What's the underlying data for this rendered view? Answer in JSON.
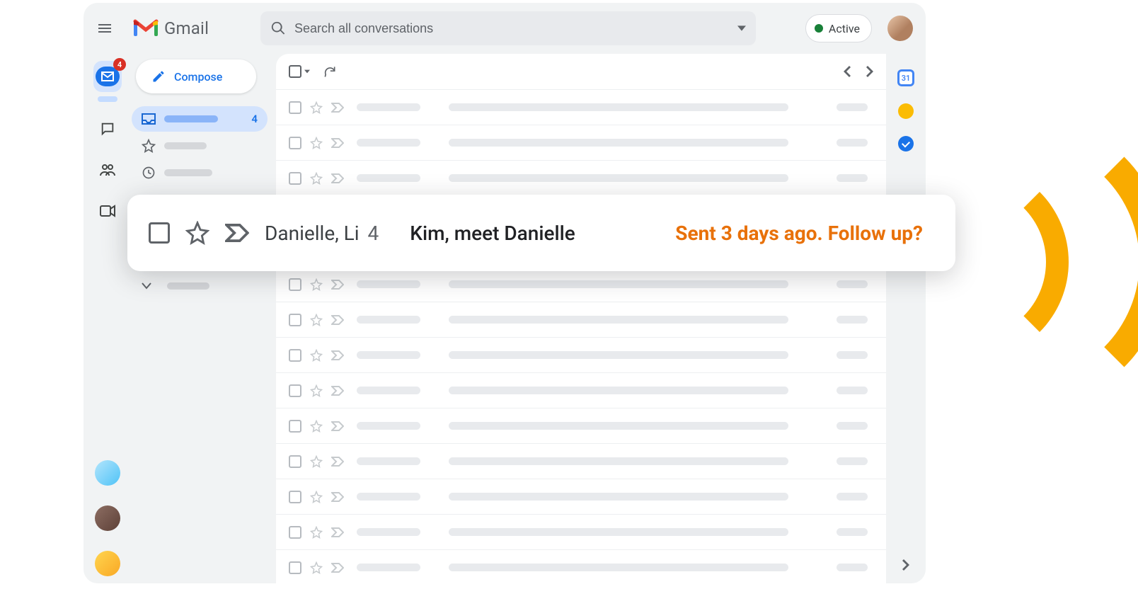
{
  "app_name": "Gmail",
  "search": {
    "placeholder": "Search all conversations"
  },
  "status": {
    "label": "Active"
  },
  "rail": {
    "mail_badge": "4"
  },
  "sidebar": {
    "compose_label": "Compose",
    "inbox_count": "4"
  },
  "sidepanel": {
    "calendar_day": "31"
  },
  "highlight": {
    "sender": "Danielle, Li",
    "count": "4",
    "subject": "Kim, meet Danielle",
    "nudge": "Sent 3 days ago. Follow up?"
  },
  "colors": {
    "accent_blue": "#1a73e8",
    "nudge_orange": "#e8710a",
    "active_green": "#188038",
    "arc_yellow": "#f9ab00"
  }
}
